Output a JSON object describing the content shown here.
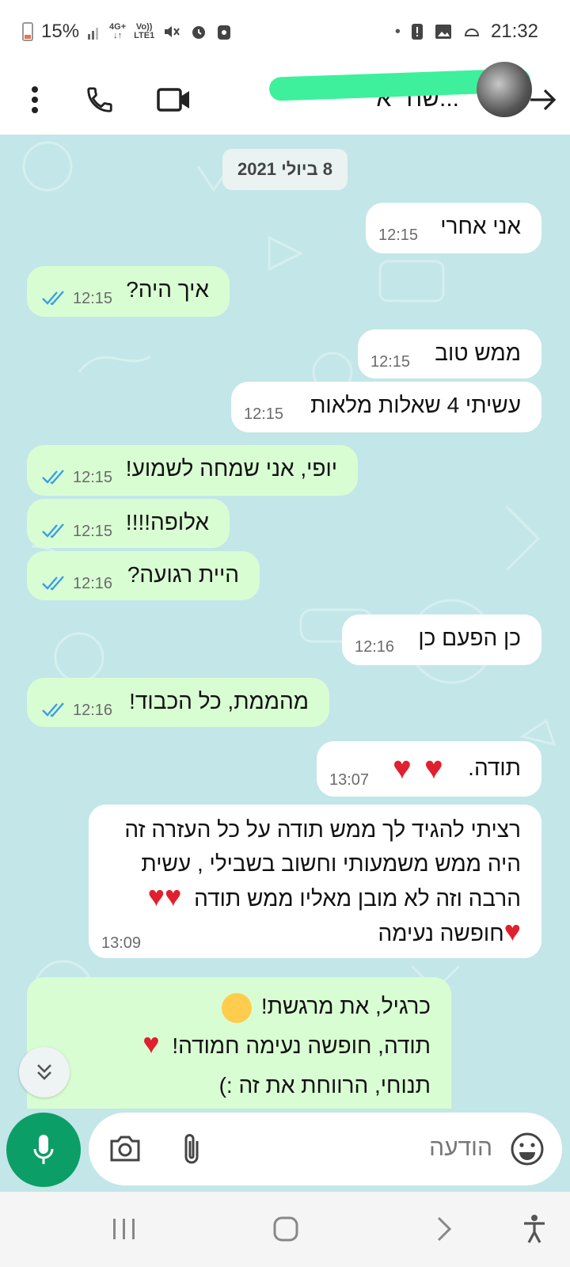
{
  "status_bar": {
    "battery": "15%",
    "network_top": "4G+",
    "network_bottom": "LTE1",
    "volte_top": "Vo))",
    "volte_bottom": "LTE1",
    "time": "21:32"
  },
  "header": {
    "contact_name": "...שח \"א"
  },
  "chat": {
    "date": "8 ביולי 2021",
    "messages": [
      {
        "text": "אני אחרי",
        "time": "12:15",
        "dir": "in"
      },
      {
        "text": "איך היה?",
        "time": "12:15",
        "dir": "out"
      },
      {
        "text": "ממש טוב",
        "time": "12:15",
        "dir": "in"
      },
      {
        "text": "עשיתי 4 שאלות מלאות",
        "time": "12:15",
        "dir": "in"
      },
      {
        "text": "יופי, אני שמחה לשמוע!",
        "time": "12:15",
        "dir": "out"
      },
      {
        "text": "אלופה!!!!",
        "time": "12:15",
        "dir": "out"
      },
      {
        "text": "היית רגועה?",
        "time": "12:16",
        "dir": "out"
      },
      {
        "text": "כן הפעם כן",
        "time": "12:16",
        "dir": "in"
      },
      {
        "text": "מהממת, כל הכבוד!",
        "time": "12:16",
        "dir": "out"
      },
      {
        "text": "תודה.",
        "time": "13:07",
        "dir": "in"
      },
      {
        "line1": "רציתי להגיד לך ממש תודה על כל העזרה זה",
        "line2": "היה ממש משמעותי וחשוב בשבילי , עשית",
        "line3": "הרבה וזה לא מובן מאליו ממש תודה",
        "line4": "חופשה נעימה",
        "time": "13:09",
        "dir": "in"
      },
      {
        "line1": "כרגיל, את מרגשת!",
        "line2": "תודה, חופשה נעימה חמודה!",
        "line3": "תנוחי, הרווחת את זה :)",
        "dir": "out"
      }
    ]
  },
  "composer": {
    "placeholder": "הודעה"
  },
  "icons": {
    "accent_green": "#0c9e67",
    "outgoing_bubble": "#d9fdd3",
    "incoming_bubble": "#ffffff",
    "chat_background": "#c3e6e8",
    "read_ticks": "#3b9fe2",
    "heart": "#e0202e"
  }
}
